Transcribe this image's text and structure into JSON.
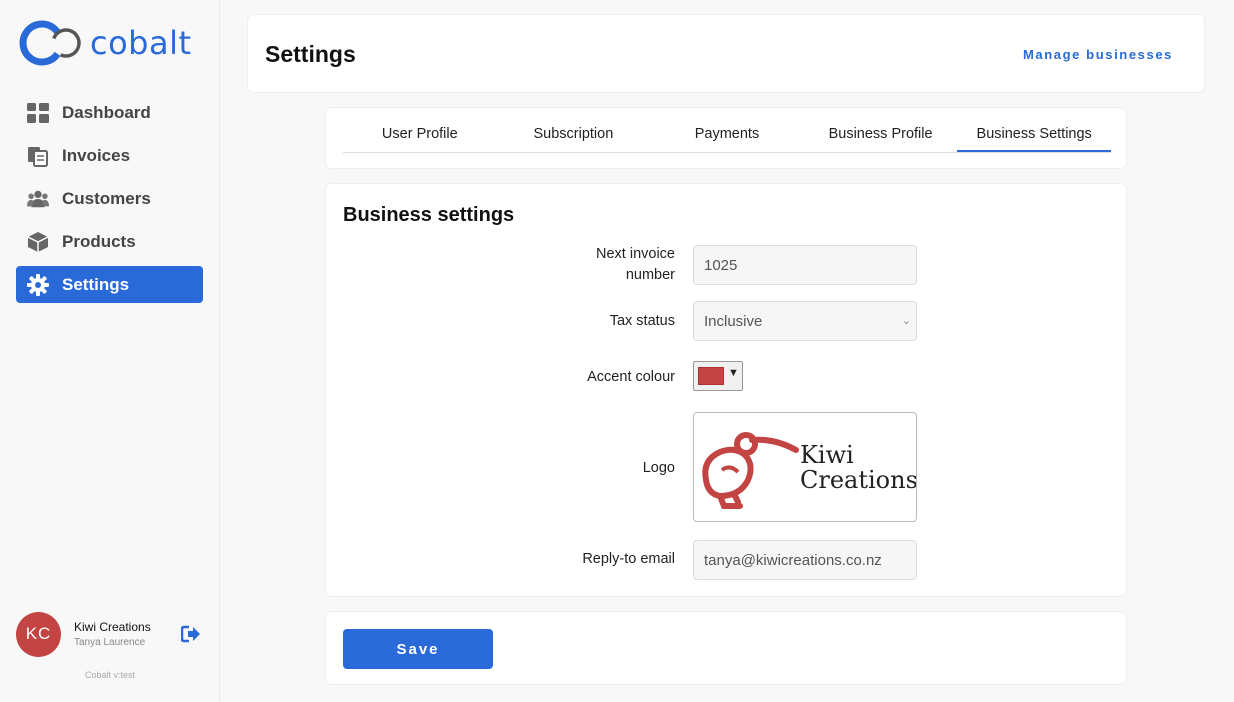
{
  "app": {
    "name": "cobalt",
    "version": "Cobalt v:test",
    "brand_color": "#2a6ad8"
  },
  "sidebar": {
    "items": [
      {
        "label": "Dashboard",
        "icon": "dashboard-icon",
        "active": false
      },
      {
        "label": "Invoices",
        "icon": "invoices-icon",
        "active": false
      },
      {
        "label": "Customers",
        "icon": "customers-icon",
        "active": false
      },
      {
        "label": "Products",
        "icon": "box-icon",
        "active": false
      },
      {
        "label": "Settings",
        "icon": "gear-icon",
        "active": true
      }
    ]
  },
  "account": {
    "initials": "KC",
    "business": "Kiwi Creations",
    "user": "Tanya Laurence",
    "avatar_color": "#c24443",
    "logout_icon": "logout-icon"
  },
  "header": {
    "title": "Settings",
    "manage_link": "Manage businesses"
  },
  "tabs": [
    {
      "label": "User Profile",
      "active": false
    },
    {
      "label": "Subscription",
      "active": false
    },
    {
      "label": "Payments",
      "active": false
    },
    {
      "label": "Business Profile",
      "active": false
    },
    {
      "label": "Business Settings",
      "active": true
    }
  ],
  "form": {
    "section_title": "Business settings",
    "next_invoice": {
      "label_line1": "Next invoice",
      "label_line2": "number",
      "value": "1025"
    },
    "tax_status": {
      "label": "Tax status",
      "value": "Inclusive"
    },
    "accent_colour": {
      "label": "Accent colour",
      "value": "#c24443"
    },
    "logo": {
      "label": "Logo",
      "text_line1": "Kiwi",
      "text_line2": "Creations",
      "color": "#c24443"
    },
    "reply_to": {
      "label": "Reply-to email",
      "value": "tanya@kiwicreations.co.nz"
    }
  },
  "actions": {
    "save_label": "Save"
  }
}
